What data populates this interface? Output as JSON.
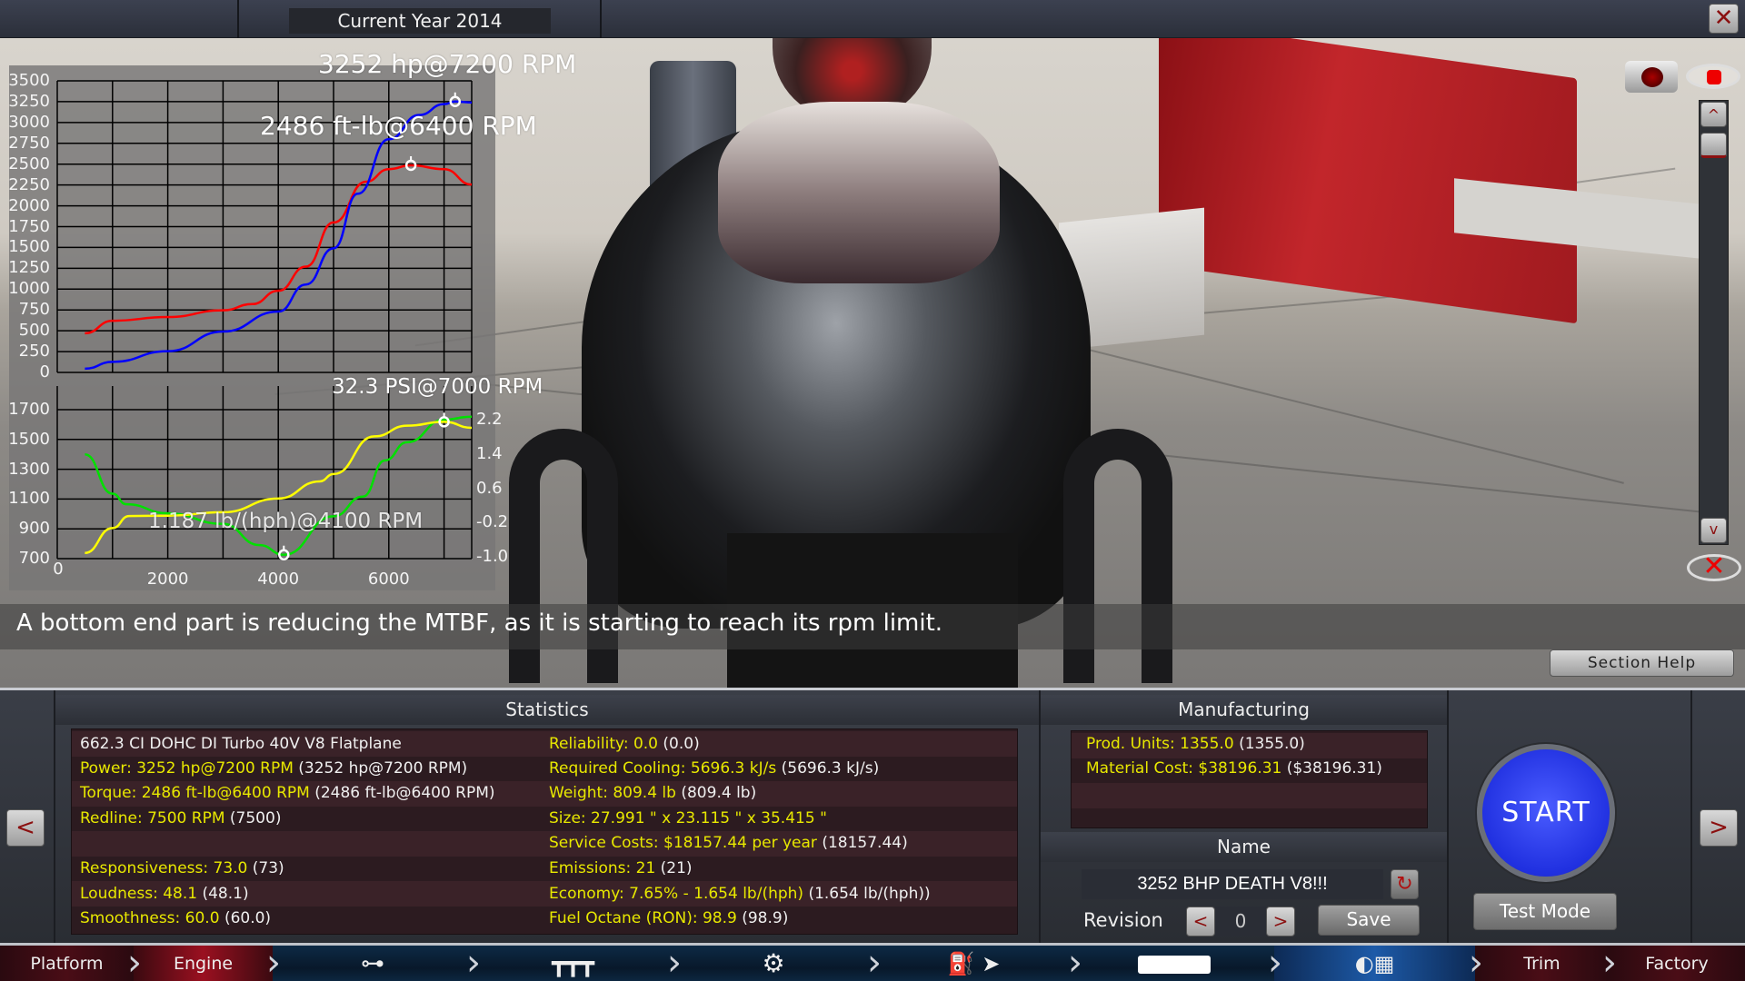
{
  "topbar": {
    "current_year": "Current Year 2014",
    "close_icon": "close-x-icon"
  },
  "message": "A bottom end part is reducing the MTBF, as it is starting to reach its rpm limit.",
  "section_help": "Section Help",
  "view_controls": {
    "camera_icon": "camera-icon",
    "eye_icon": "eye-icon",
    "hide_icon": "eye-crossed-icon",
    "scroll_up": "^",
    "scroll_down": "v"
  },
  "statistics": {
    "title": "Statistics",
    "left": [
      {
        "label": "662.3 CI DOHC DI Turbo 40V V8 Flatplane",
        "prev": ""
      },
      {
        "label": "Power: 3252 hp@7200 RPM",
        "prev": "(3252 hp@7200 RPM)"
      },
      {
        "label": "Torque: 2486 ft-lb@6400 RPM",
        "prev": "(2486 ft-lb@6400 RPM)"
      },
      {
        "label": "Redline: 7500 RPM",
        "prev": "(7500)"
      },
      {
        "label": "",
        "prev": ""
      },
      {
        "label": "Responsiveness: 73.0",
        "prev": "(73)"
      },
      {
        "label": "Loudness: 48.1",
        "prev": "(48.1)"
      },
      {
        "label": "Smoothness: 60.0",
        "prev": "(60.0)"
      }
    ],
    "right": [
      {
        "label": "Reliability: 0.0",
        "prev": "(0.0)"
      },
      {
        "label": "Required Cooling: 5696.3 kJ/s",
        "prev": "(5696.3 kJ/s)"
      },
      {
        "label": "Weight: 809.4 lb",
        "prev": "(809.4 lb)"
      },
      {
        "label": "Size: 27.991 \" x 23.115 \" x 35.415 \"",
        "prev": ""
      },
      {
        "label": "Service Costs: $18157.44 per year",
        "prev": "(18157.44)"
      },
      {
        "label": "Emissions: 21",
        "prev": "(21)"
      },
      {
        "label": "Economy: 7.65% - 1.654 lb/(hph)",
        "prev": "(1.654 lb/(hph))"
      },
      {
        "label": "Fuel Octane (RON): 98.9",
        "prev": "(98.9)"
      }
    ]
  },
  "manufacturing": {
    "title": "Manufacturing",
    "rows": [
      {
        "label": "Prod. Units: 1355.0",
        "prev": "(1355.0)"
      },
      {
        "label": "Material Cost: $38196.31",
        "prev": "($38196.31)"
      }
    ]
  },
  "name_section": {
    "title": "Name",
    "value": "3252 BHP DEATH V8!!!",
    "revision_label": "Revision",
    "revision": "0",
    "prev": "<",
    "next": ">",
    "save": "Save"
  },
  "actions": {
    "start": "START",
    "test_mode": "Test Mode",
    "nav_left": "<",
    "nav_right": ">"
  },
  "nav": [
    {
      "label": "Platform"
    },
    {
      "label": "Engine",
      "active": true
    },
    {
      "icon": "bottom-end-icon"
    },
    {
      "icon": "top-end-icon"
    },
    {
      "icon": "turbo-icon"
    },
    {
      "icon": "fuel-system-icon"
    },
    {
      "icon": "exhaust-icon"
    },
    {
      "icon": "tuning-icon",
      "active": true
    },
    {
      "label": "Trim"
    },
    {
      "label": "Factory"
    }
  ],
  "chart_data": [
    {
      "type": "line",
      "xlim": [
        0,
        7500
      ],
      "ylim": [
        0,
        3500
      ],
      "yticks": [
        "0",
        "250",
        "500",
        "750",
        "1000",
        "1250",
        "1500",
        "1750",
        "2000",
        "2250",
        "2500",
        "2750",
        "3000",
        "3250",
        "3500"
      ],
      "grid": true,
      "annotations": [
        "3252 hp@7200 RPM",
        "2486 ft-lb@6400 RPM"
      ],
      "series": [
        {
          "color": "#ff0000",
          "x": [
            500,
            1000,
            2000,
            3000,
            3530,
            4000,
            4500,
            5000,
            5590,
            6000,
            6400,
            7000,
            7500
          ],
          "y": [
            470,
            620,
            665,
            745,
            820,
            980,
            1270,
            1800,
            2290,
            2440,
            2486,
            2440,
            2255
          ],
          "peak": [
            6400,
            2486
          ]
        },
        {
          "color": "#0000ff",
          "x": [
            500,
            1000,
            2000,
            3000,
            4000,
            4500,
            5000,
            5440,
            6000,
            6550,
            7000,
            7200,
            7500
          ],
          "y": [
            45,
            127,
            255,
            490,
            730,
            1055,
            1490,
            2145,
            2800,
            3090,
            3220,
            3252,
            3240
          ],
          "peak": [
            7200,
            3252
          ]
        }
      ]
    },
    {
      "type": "line",
      "xlim": [
        0,
        7500
      ],
      "ylim": [
        700,
        1700
      ],
      "y2lim": [
        -1.0,
        2.2
      ],
      "xticks": [
        "0",
        "2000",
        "4000",
        "6000"
      ],
      "yticks": [
        "700",
        "900",
        "1100",
        "1300",
        "1500",
        "1700"
      ],
      "y2ticks": [
        "-1.0",
        "-0.2",
        "0.6",
        "1.4",
        "2.2"
      ],
      "grid": true,
      "annotations": [
        "32.3 PSI@7000 RPM",
        "1.187 lb/(hph)@4100 RPM"
      ],
      "series": [
        {
          "color": "#00e000",
          "axis": "left",
          "x": [
            500,
            1000,
            1250,
            2000,
            3000,
            3660,
            4100,
            5000,
            5530,
            5930,
            6330,
            7000,
            7500
          ],
          "y": [
            1400,
            1136,
            1065,
            1004,
            933,
            791,
            726,
            984,
            1116,
            1359,
            1481,
            1633,
            1653
          ],
          "peak": [
            4100,
            726
          ]
        },
        {
          "color": "#ffff00",
          "axis": "right",
          "x": [
            500,
            1000,
            1300,
            2000,
            3000,
            4000,
            4750,
            5000,
            5740,
            6330,
            7000,
            7500
          ],
          "y": [
            -0.91,
            -0.33,
            -0.05,
            -0.04,
            0.04,
            0.36,
            0.76,
            0.93,
            1.81,
            2.06,
            2.15,
            2.01
          ],
          "peak": [
            7000,
            2.15
          ]
        }
      ]
    }
  ]
}
